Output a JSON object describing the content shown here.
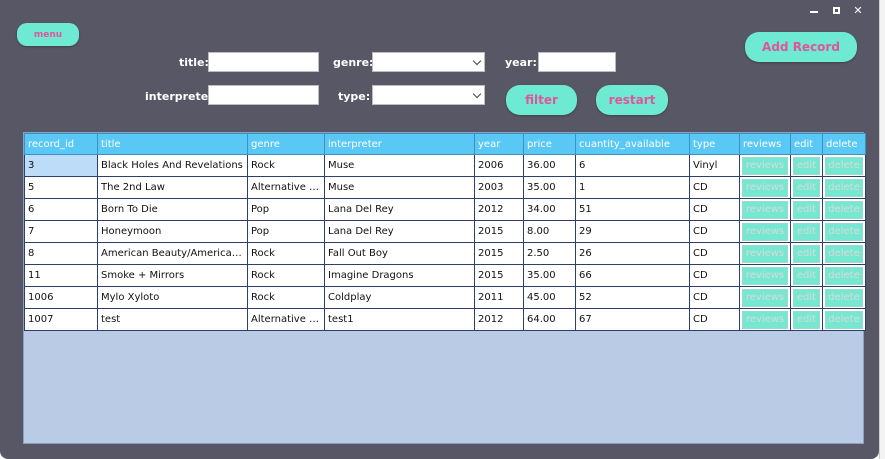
{
  "menu": {
    "label": "menu"
  },
  "add_record": {
    "label": "Add Record"
  },
  "filters": {
    "title_label": "title:",
    "genre_label": "genre:",
    "year_label": "year:",
    "interpreter_label": "interpreter:",
    "type_label": "type:",
    "title_value": "",
    "genre_value": "",
    "year_value": "",
    "interpreter_value": "",
    "type_value": ""
  },
  "filter_button": {
    "label": "filter"
  },
  "restart_button": {
    "label": "restart"
  },
  "window_controls": {
    "minimize": "minimize-icon",
    "maximize": "maximize-icon",
    "close": "✕"
  },
  "table": {
    "columns": [
      "record_id",
      "title",
      "genre",
      "interpreter",
      "year",
      "price",
      "cuantity_available",
      "type",
      "reviews",
      "edit",
      "delete"
    ],
    "rows": [
      [
        "3",
        "Black Holes And Revelations",
        "Rock",
        "Muse",
        "2006",
        "36.00",
        "6",
        "Vinyl"
      ],
      [
        "5",
        "The 2nd Law",
        "Alternative Rock",
        "Muse",
        "2003",
        "35.00",
        "1",
        "CD"
      ],
      [
        "6",
        "Born To Die",
        "Pop",
        "Lana Del Rey",
        "2012",
        "34.00",
        "51",
        "CD"
      ],
      [
        "7",
        "Honeymoon",
        "Pop",
        "Lana Del Rey",
        "2015",
        "8.00",
        "29",
        "CD"
      ],
      [
        "8",
        "American Beauty/American Psy...",
        "Rock",
        "Fall Out Boy",
        "2015",
        "2.50",
        "26",
        "CD"
      ],
      [
        "11",
        "Smoke + Mirrors",
        "Rock",
        "Imagine Dragons",
        "2015",
        "35.00",
        "66",
        "CD"
      ],
      [
        "1006",
        "Mylo Xyloto",
        "Rock",
        "Coldplay",
        "2011",
        "45.00",
        "52",
        "CD"
      ],
      [
        "1007",
        "test",
        "Alternative Rock",
        "test1",
        "2012",
        "64.00",
        "67",
        "CD"
      ]
    ],
    "action_labels": {
      "reviews": "reviews",
      "edit": "edit",
      "delete": "delete"
    }
  },
  "colors": {
    "window_bg": "#575765",
    "accent": "#6ee9d2",
    "accent_text": "#e0559a",
    "header_bg": "#5ac8f5",
    "grid_bg": "#b9cbe5"
  }
}
